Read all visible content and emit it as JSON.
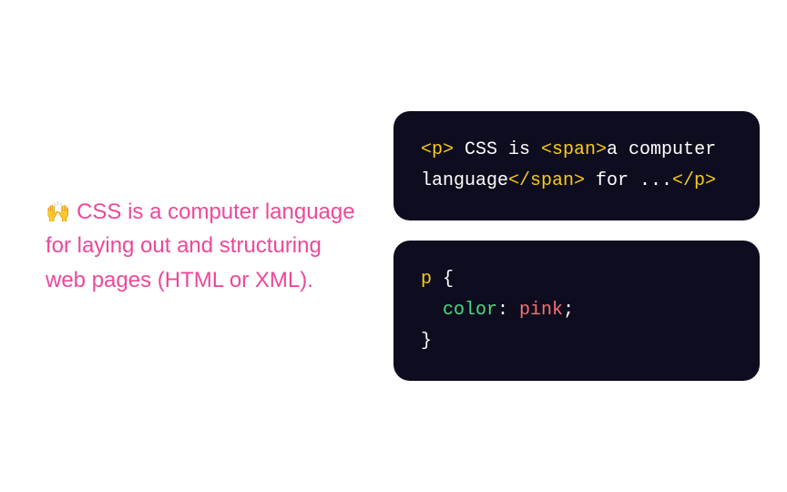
{
  "description": {
    "emoji": "🙌",
    "text": " CSS is a computer language for laying out and structuring web pages (HTML or XML)."
  },
  "html_code": {
    "t1": "<p>",
    "p1": " CSS is ",
    "t2": "<span>",
    "p2": "a computer language",
    "t3": "</span>",
    "p3": " for ...",
    "t4": "</p>"
  },
  "css_code": {
    "selector": "p",
    "open_brace": " {",
    "indent": "  ",
    "property": "color",
    "colon": ": ",
    "value": "pink",
    "semicolon": ";",
    "close_brace": "}"
  }
}
